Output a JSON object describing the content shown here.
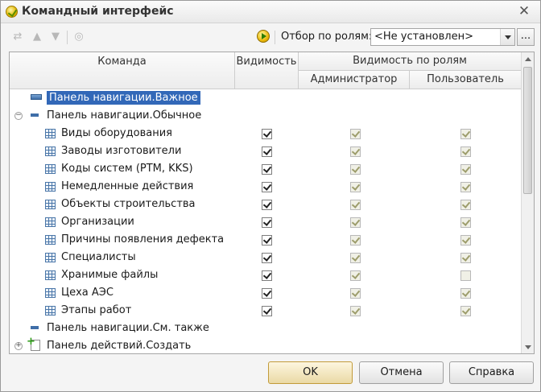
{
  "window": {
    "title": "Командный интерфейс",
    "close_glyph": "✕"
  },
  "toolbar": {
    "filter_label": "Отбор по ролям:",
    "filter_value": "<Не установлен>",
    "more_label": "..."
  },
  "grid": {
    "columns": {
      "command": "Команда",
      "visibility": "Видимость",
      "role_visibility": "Видимость по ролям",
      "admin": "Администратор",
      "user": "Пользователь"
    },
    "rows": [
      {
        "label": "Панель навигации.Важное",
        "kind": "panel",
        "level": 0,
        "selected": true
      },
      {
        "label": "Панель навигации.Обычное",
        "kind": "panel-small",
        "level": 0,
        "expander": "−"
      },
      {
        "label": "Виды оборудования",
        "kind": "table",
        "level": 1,
        "vis": true,
        "admin": true,
        "user": true
      },
      {
        "label": "Заводы изготовители",
        "kind": "table",
        "level": 1,
        "vis": true,
        "admin": true,
        "user": true
      },
      {
        "label": "Коды систем (PTM, KKS)",
        "kind": "table",
        "level": 1,
        "vis": true,
        "admin": true,
        "user": true
      },
      {
        "label": "Немедленные действия",
        "kind": "table",
        "level": 1,
        "vis": true,
        "admin": true,
        "user": true
      },
      {
        "label": "Объекты строительства",
        "kind": "table",
        "level": 1,
        "vis": true,
        "admin": true,
        "user": true
      },
      {
        "label": "Организации",
        "kind": "table",
        "level": 1,
        "vis": true,
        "admin": true,
        "user": true
      },
      {
        "label": "Причины появления дефекта",
        "kind": "table",
        "level": 1,
        "vis": true,
        "admin": true,
        "user": true
      },
      {
        "label": "Специалисты",
        "kind": "table",
        "level": 1,
        "vis": true,
        "admin": true,
        "user": true
      },
      {
        "label": "Хранимые файлы",
        "kind": "table",
        "level": 1,
        "vis": true,
        "admin": true,
        "user": false
      },
      {
        "label": "Цеха АЭС",
        "kind": "table",
        "level": 1,
        "vis": true,
        "admin": true,
        "user": true
      },
      {
        "label": "Этапы работ",
        "kind": "table",
        "level": 1,
        "vis": true,
        "admin": true,
        "user": true
      },
      {
        "label": "Панель навигации.См. также",
        "kind": "panel-small",
        "level": 0
      },
      {
        "label": "Панель действий.Создать",
        "kind": "create",
        "level": 0,
        "expander": "+"
      }
    ]
  },
  "buttons": {
    "ok": "OK",
    "cancel": "Отмена",
    "help": "Справка"
  }
}
